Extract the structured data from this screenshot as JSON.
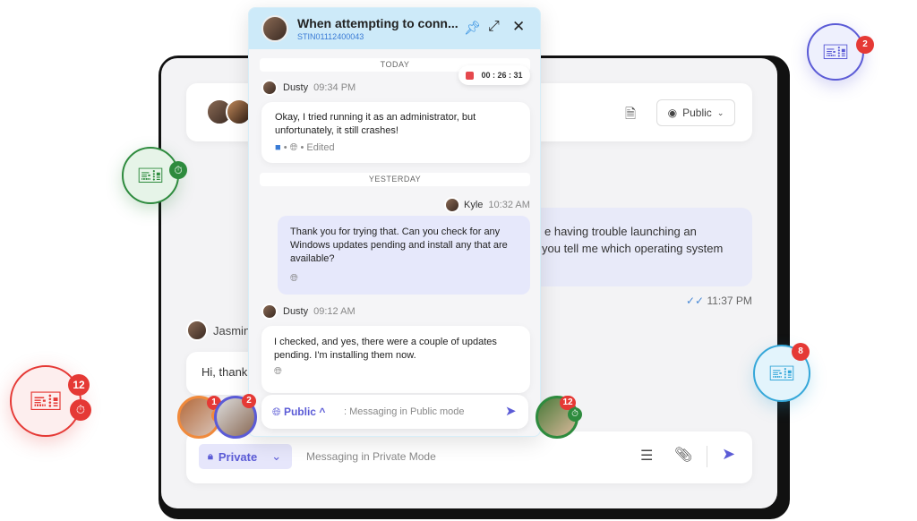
{
  "popup": {
    "title": "When attempting to conn...",
    "ticket_id": "STIN01112400043",
    "timer": "00 : 26 : 31",
    "sep_today": "TODAY",
    "sep_yesterday": "YESTERDAY",
    "messages": [
      {
        "author": "Dusty",
        "time": "09:34 PM",
        "text_1": "Okay, I tried running it as an administrator, but",
        "text_2": "unfortunately, it still crashes!",
        "status": "Edited"
      },
      {
        "author": "Kyle",
        "time": "10:32 AM",
        "text_1": "Thank you for trying that. Can you check for any",
        "text_2": "Windows updates pending and install any that are",
        "text_3": "available?"
      },
      {
        "author": "Dusty",
        "time": "09:12 AM",
        "text_1": "I checked, and yes, there were a couple of updates",
        "text_2": "pending. I'm installing them now."
      }
    ],
    "composer": {
      "mode": "Public",
      "placeholder": ": Messaging in Public mode"
    }
  },
  "main": {
    "visibility": "Public",
    "bg_message_1": "e having trouble launching an",
    "bg_message_2": "you tell me which operating system",
    "bg_time": "11:37 PM",
    "jasmine_name": "Jasmin",
    "jasmine_text": "Hi, thank",
    "composer": {
      "mode": "Private",
      "placeholder": "Messaging in Private Mode"
    }
  },
  "floating": {
    "green_badge": "",
    "blue_badge": "2",
    "red_badge": "12",
    "cyan_badge": "8",
    "avatar_1_badge": "1",
    "avatar_2_badge": "2",
    "avatar_3_badge": "12"
  },
  "colors": {
    "accent": "#5b5bd6",
    "popup_header": "#cdeaf9",
    "green": "#2e8b3e",
    "red": "#e53935",
    "blue": "#5b5bd6",
    "cyan": "#35a7d9"
  }
}
